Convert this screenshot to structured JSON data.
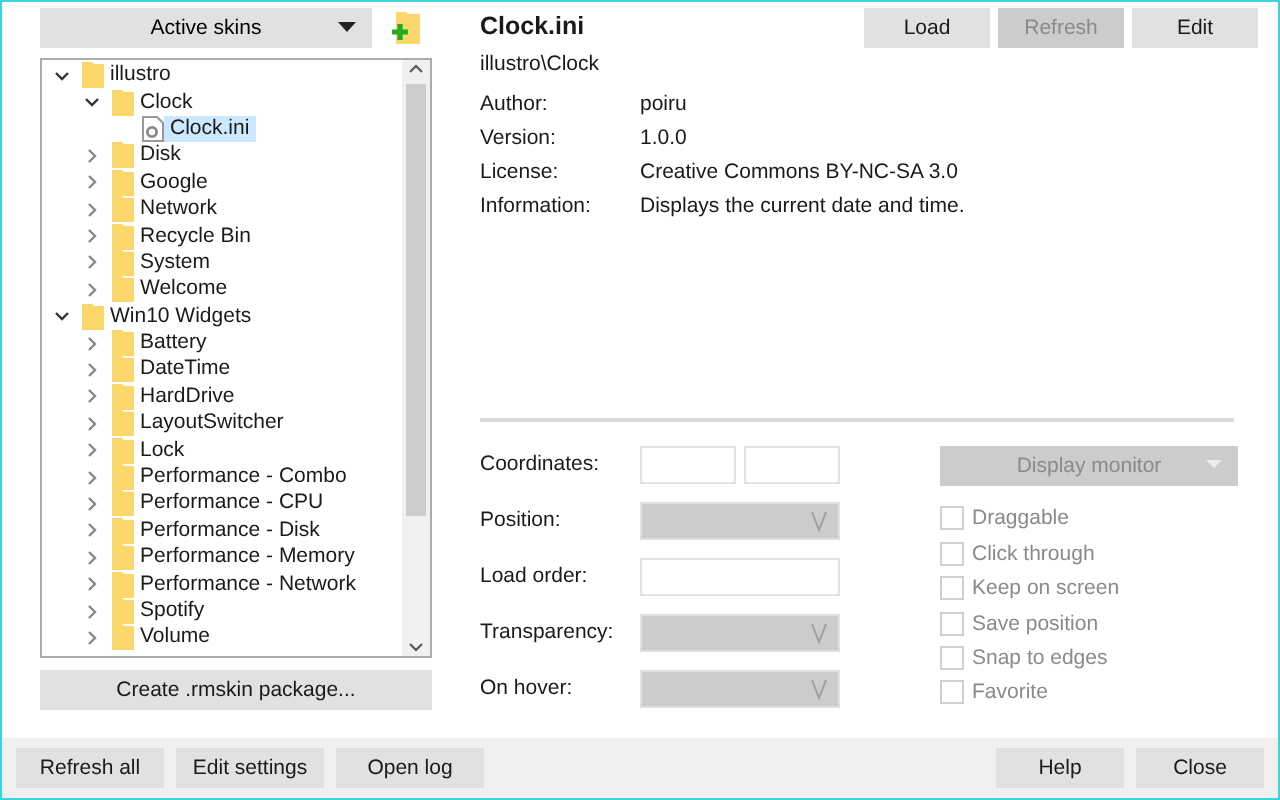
{
  "skins_dropdown": {
    "label": "Active skins"
  },
  "tree": [
    {
      "label": "illustro",
      "kind": "folder",
      "expanded": true,
      "selected": false,
      "children": [
        {
          "label": "Clock",
          "kind": "folder",
          "expanded": true,
          "selected": false,
          "children": [
            {
              "label": "Clock.ini",
              "kind": "file",
              "selected": true
            }
          ]
        },
        {
          "label": "Disk",
          "kind": "folder",
          "expanded": false,
          "selected": false
        },
        {
          "label": "Google",
          "kind": "folder",
          "expanded": false,
          "selected": false
        },
        {
          "label": "Network",
          "kind": "folder",
          "expanded": false,
          "selected": false
        },
        {
          "label": "Recycle Bin",
          "kind": "folder",
          "expanded": false,
          "selected": false
        },
        {
          "label": "System",
          "kind": "folder",
          "expanded": false,
          "selected": false
        },
        {
          "label": "Welcome",
          "kind": "folder",
          "expanded": false,
          "selected": false
        }
      ]
    },
    {
      "label": "Win10 Widgets",
      "kind": "folder",
      "expanded": true,
      "selected": false,
      "children": [
        {
          "label": "Battery",
          "kind": "folder",
          "expanded": false,
          "selected": false
        },
        {
          "label": "DateTime",
          "kind": "folder",
          "expanded": false,
          "selected": false
        },
        {
          "label": "HardDrive",
          "kind": "folder",
          "expanded": false,
          "selected": false
        },
        {
          "label": "LayoutSwitcher",
          "kind": "folder",
          "expanded": false,
          "selected": false
        },
        {
          "label": "Lock",
          "kind": "folder",
          "expanded": false,
          "selected": false
        },
        {
          "label": "Performance - Combo",
          "kind": "folder",
          "expanded": false,
          "selected": false
        },
        {
          "label": "Performance - CPU",
          "kind": "folder",
          "expanded": false,
          "selected": false
        },
        {
          "label": "Performance - Disk",
          "kind": "folder",
          "expanded": false,
          "selected": false
        },
        {
          "label": "Performance - Memory",
          "kind": "folder",
          "expanded": false,
          "selected": false
        },
        {
          "label": "Performance - Network",
          "kind": "folder",
          "expanded": false,
          "selected": false
        },
        {
          "label": "Spotify",
          "kind": "folder",
          "expanded": false,
          "selected": false
        },
        {
          "label": "Volume",
          "kind": "folder",
          "expanded": false,
          "selected": false
        }
      ]
    }
  ],
  "create_button": "Create .rmskin package...",
  "skin": {
    "title": "Clock.ini",
    "path": "illustro\\Clock",
    "info": [
      {
        "label": "Author:",
        "value": "poiru"
      },
      {
        "label": "Version:",
        "value": "1.0.0"
      },
      {
        "label": "License:",
        "value": "Creative Commons BY-NC-SA 3.0"
      },
      {
        "label": "Information:",
        "value": "Displays the current date and time."
      }
    ]
  },
  "skin_buttons": [
    {
      "label": "Load",
      "disabled": false
    },
    {
      "label": "Refresh",
      "disabled": true
    },
    {
      "label": "Edit",
      "disabled": false
    }
  ],
  "settings": [
    {
      "label": "Coordinates:",
      "kind": "pair",
      "disabled": false
    },
    {
      "label": "Position:",
      "kind": "select",
      "disabled": true
    },
    {
      "label": "Load order:",
      "kind": "text",
      "disabled": false
    },
    {
      "label": "Transparency:",
      "kind": "select",
      "disabled": true
    },
    {
      "label": "On hover:",
      "kind": "select",
      "disabled": true
    }
  ],
  "monitor_dropdown": {
    "label": "Display monitor",
    "disabled": true
  },
  "options": [
    {
      "label": "Draggable",
      "checked": false,
      "disabled": true
    },
    {
      "label": "Click through",
      "checked": false,
      "disabled": true
    },
    {
      "label": "Keep on screen",
      "checked": false,
      "disabled": true
    },
    {
      "label": "Save position",
      "checked": false,
      "disabled": true
    },
    {
      "label": "Snap to edges",
      "checked": false,
      "disabled": true
    },
    {
      "label": "Favorite",
      "checked": false,
      "disabled": true
    }
  ],
  "footer_left": [
    "Refresh all",
    "Edit settings",
    "Open log"
  ],
  "footer_right": [
    "Help",
    "Close"
  ]
}
